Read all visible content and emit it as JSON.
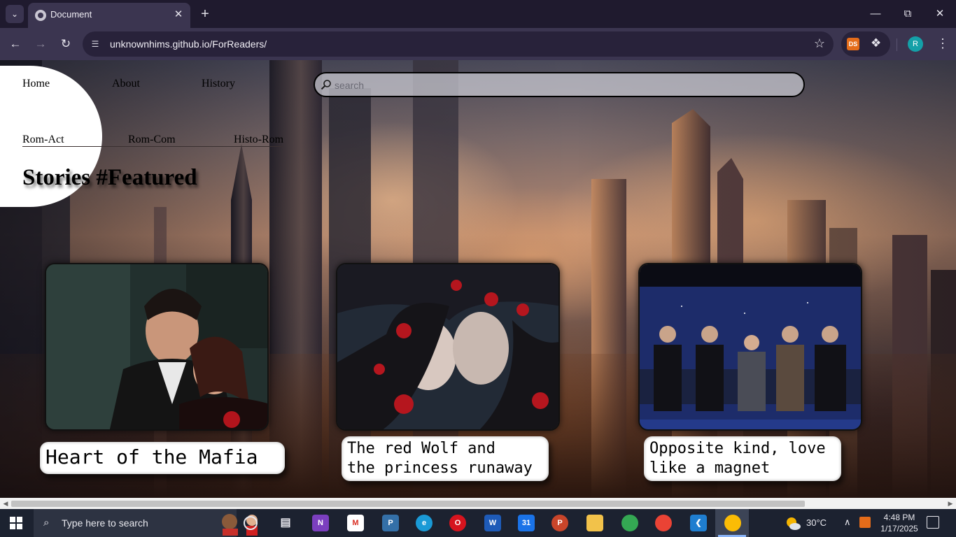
{
  "browser": {
    "tab_title": "Document",
    "url": "unknownhims.github.io/ForReaders/",
    "extension_label": "DS",
    "profile_initial": "R"
  },
  "nav": {
    "home": "Home",
    "about": "About",
    "history": "History"
  },
  "genres": {
    "rom_act": "Rom-Act",
    "rom_com": "Rom-Com",
    "histo_rom": "Histo-Rom"
  },
  "search": {
    "placeholder": "search",
    "value": ""
  },
  "featured": {
    "title": "Stories #Featured",
    "stories": [
      {
        "title": "Heart of the Mafia"
      },
      {
        "title": "The red Wolf and\nthe princess runaway"
      },
      {
        "title": "Opposite kind, love\nlike a magnet"
      }
    ]
  },
  "taskbar": {
    "search_placeholder": "Type here to search",
    "weather": "30°C",
    "time": "4:48 PM",
    "date": "1/17/2025"
  },
  "colors": {
    "chrome_dark": "#1f1a2e",
    "chrome_toolbar": "#3b3550",
    "caption_bg": "#ffffff",
    "taskbar_bg": "#1c2230"
  }
}
